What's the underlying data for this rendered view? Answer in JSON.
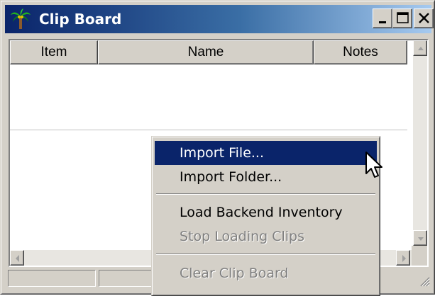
{
  "window": {
    "title": "Clip Board",
    "icon": "palm-tree-icon",
    "controls": [
      "minimize-icon",
      "maximize-icon",
      "close-icon"
    ]
  },
  "table": {
    "columns": [
      "Item",
      "Name",
      "Notes"
    ],
    "rows": []
  },
  "context_menu": {
    "items": [
      {
        "label": "Import File...",
        "state": "highlighted"
      },
      {
        "label": "Import Folder...",
        "state": "enabled"
      },
      {
        "label": "Load Backend Inventory",
        "state": "enabled"
      },
      {
        "label": "Stop Loading Clips",
        "state": "disabled"
      },
      {
        "label": "Clear Clip Board",
        "state": "disabled"
      }
    ]
  },
  "colors": {
    "titlebar_start": "#0a246a",
    "titlebar_end": "#a6caf0",
    "menu_highlight": "#0a246a",
    "face": "#d4d0c8"
  }
}
